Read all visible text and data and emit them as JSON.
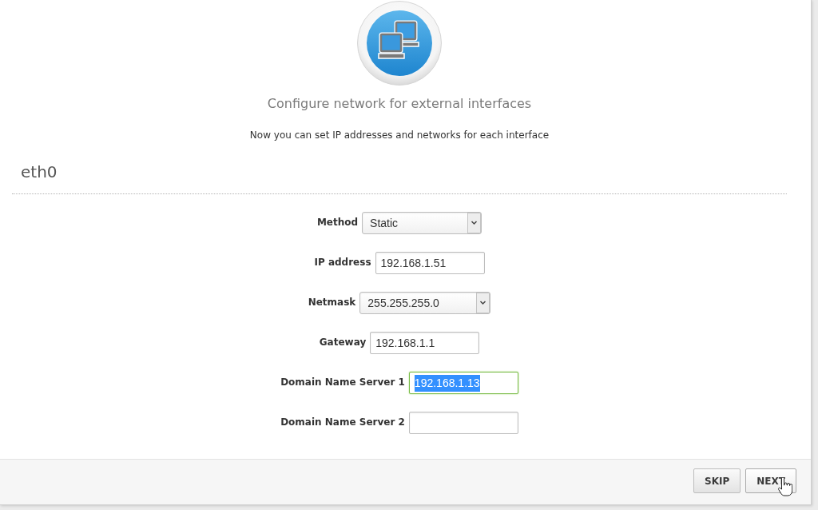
{
  "header": {
    "title": "Configure network for external interfaces",
    "subtitle": "Now you can set IP addresses and networks for each interface"
  },
  "interface": {
    "name": "eth0"
  },
  "fields": [
    {
      "label": "Method",
      "kind": "select",
      "value": "Static",
      "focused": false,
      "text_selected": false
    },
    {
      "label": "IP address",
      "kind": "text",
      "value": "192.168.1.51",
      "focused": false,
      "text_selected": false
    },
    {
      "label": "Netmask",
      "kind": "select",
      "value": "255.255.255.0",
      "focused": false,
      "text_selected": false
    },
    {
      "label": "Gateway",
      "kind": "text",
      "value": "192.168.1.1",
      "focused": false,
      "text_selected": false
    },
    {
      "label": "Domain Name Server 1",
      "kind": "text",
      "value": "192.168.1.13",
      "focused": true,
      "text_selected": true
    },
    {
      "label": "Domain Name Server 2",
      "kind": "text",
      "focused": false
    }
  ],
  "buttons": [
    {
      "label": "SKIP",
      "hovered": false
    },
    {
      "label": "NEXT",
      "hovered": true
    }
  ]
}
